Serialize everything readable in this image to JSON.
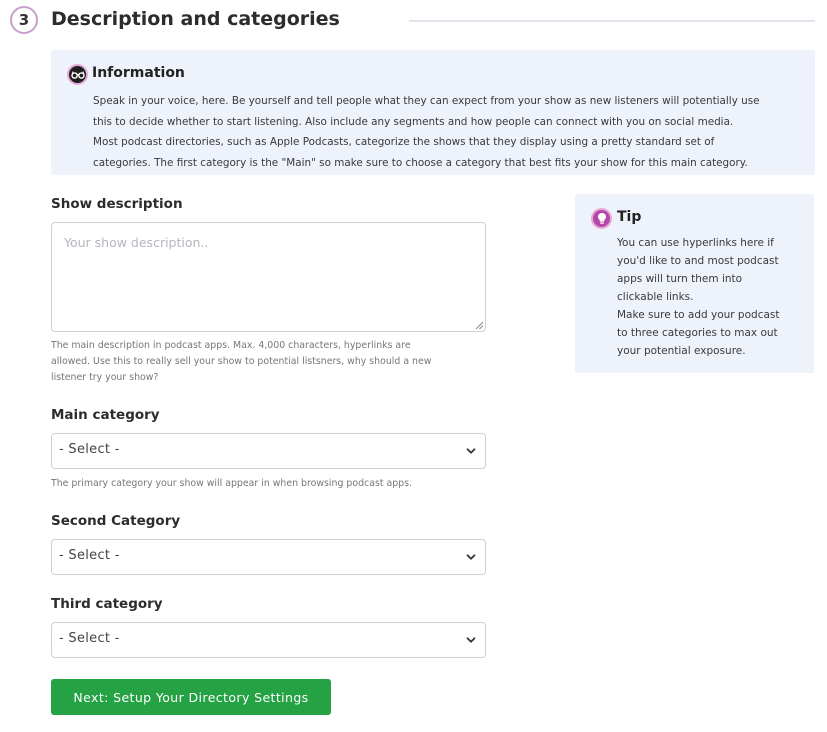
{
  "step": {
    "number": "3",
    "title": "Description and categories"
  },
  "info": {
    "icon": "glasses-icon",
    "title": "Information",
    "lines": [
      "Speak in your voice, here. Be yourself and tell people what they can expect from your show as new listeners will potentially use",
      "this to decide whether to start listening. Also include any segments and how people can connect with you on social media.",
      "Most podcast directories, such as Apple Podcasts, categorize the shows that they display using a pretty standard set of",
      "categories. The first category is the \"Main\" so make sure to choose a category that best fits your show for this main category."
    ]
  },
  "description": {
    "label": "Show description",
    "placeholder": "Your show description..",
    "value": "",
    "help_lines": [
      "The main description in podcast apps. Max. 4,000 characters, hyperlinks are",
      "allowed. Use this to really sell your show to potential listsners, why should a new",
      "listener try your show?"
    ]
  },
  "tip": {
    "icon": "lightbulb-icon",
    "title": "Tip",
    "lines": [
      "You can use hyperlinks here if",
      "you'd like to and most podcast",
      "apps will turn them into",
      "clickable links.",
      "Make sure to add your podcast",
      "to three categories to max out",
      "your potential exposure."
    ]
  },
  "main_category": {
    "label": "Main category",
    "value": "- Select -",
    "help": "The primary category your show will appear in when browsing podcast apps."
  },
  "second_category": {
    "label": "Second Category",
    "value": "- Select -"
  },
  "third_category": {
    "label": "Third category",
    "value": "- Select -"
  },
  "next_button": {
    "label": "Next: Setup Your Directory Settings"
  },
  "colors": {
    "accent_green": "#25a244",
    "badge_border": "#c8a0cc",
    "panel_bg": "#eef2fa",
    "tip_icon": "#b549a9"
  }
}
